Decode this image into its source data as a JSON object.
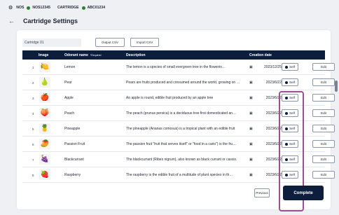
{
  "topbar": {
    "nos_label": "NOS",
    "nos_value": "NOS12345",
    "cartridge_label": "CARTRIDGE",
    "cartridge_value": "ABC01234"
  },
  "header": {
    "title": "Cartridge Settings"
  },
  "toolbar": {
    "cartridge_name": "Cartridge 01",
    "output_csv": "Output CSV",
    "import_csv": "Import CSV"
  },
  "table": {
    "columns": {
      "image": "Image",
      "odorant": "Odorant name",
      "required": "*Required",
      "description": "Description",
      "date": "Creation date"
    },
    "rows": [
      {
        "num": "1",
        "icon": "lemon-image",
        "emoji": "🍋",
        "name": "Lemon",
        "desc": "The lemon is a species of small evergreen tree in the floweirin…",
        "date": "2023/12/25",
        "self": "Self",
        "edit": "Edit"
      },
      {
        "num": "2",
        "icon": "pear-image",
        "emoji": "🍐",
        "name": "Pear",
        "desc": "Pears are fruits produced and consumed around the world, growing on …",
        "date": "2023/6/22",
        "self": "Self",
        "edit": "Edit"
      },
      {
        "num": "3",
        "icon": "apple-image",
        "emoji": "🍎",
        "name": "Apple",
        "desc": "An apple is round, edible fruit produced by an apple tree",
        "date": "2023/6/22",
        "self": "Self",
        "edit": "Edit"
      },
      {
        "num": "4",
        "icon": "peach-image",
        "emoji": "🍑",
        "name": "Peach",
        "desc": "The peach (prunus persica) is a deciduous tree first domesticated an…",
        "date": "2023/6/22",
        "self": "Self",
        "edit": "Edit"
      },
      {
        "num": "5",
        "icon": "pineapple-image",
        "emoji": "🍍",
        "name": "Pineapple",
        "desc": "The pineapple (Ananas comosus) is a tropical plant with an edible fruit",
        "date": "2023/6/22",
        "self": "Self",
        "edit": "Edit"
      },
      {
        "num": "6",
        "icon": "passion-fruit-image",
        "emoji": "🥭",
        "name": "Passion Fruit",
        "desc": "The passion fruit \"fruit that serves itself\" or \"food in a cario\") is the fru…",
        "date": "2023/6/22",
        "self": "Self",
        "edit": "Edit"
      },
      {
        "num": "7",
        "icon": "blackcurrant-image",
        "emoji": "🍇",
        "name": "Blackcurrant",
        "desc": "The blackcurrant (Ribes nigrum), also known as black currant or cassis.",
        "date": "2023/6/22",
        "self": "Self",
        "edit": "Edit"
      },
      {
        "num": "8",
        "icon": "raspberry-image",
        "emoji": "🍓",
        "name": "Raspberry",
        "desc": "The raspberry is the edible fruit of a multitude of plant species in th…",
        "date": "2023/6/22",
        "self": "Self",
        "edit": "Edit"
      }
    ]
  },
  "footer": {
    "previous": "Previous",
    "complete": "Complete"
  },
  "colors": {
    "navy": "#0d1e3c",
    "highlight": "#9e4f92",
    "status_green": "#2e7d32"
  }
}
